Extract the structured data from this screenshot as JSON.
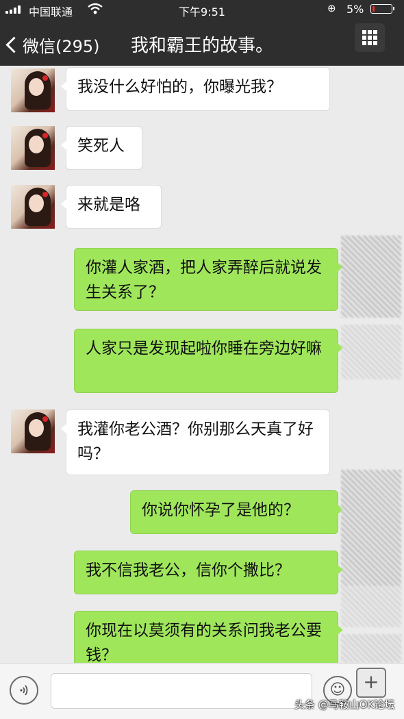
{
  "status_bar": {
    "carrier": "中国联通",
    "time": "下午9:51",
    "battery": "5%",
    "icons": [
      "signal-icon",
      "wifi-icon",
      "orientation-lock-icon",
      "battery-icon"
    ]
  },
  "nav": {
    "back_label": "微信(295)",
    "title": "我和霸王的故事。",
    "more_icon": "grid-menu-icon"
  },
  "messages": [
    {
      "side": "left",
      "text": "我没什么好怕的，你曝光我？"
    },
    {
      "side": "left",
      "text": "笑死人"
    },
    {
      "side": "left",
      "text": "来就是咯"
    },
    {
      "side": "right",
      "text": "你灌人家酒，把人家弄醉后就说发生关系了？"
    },
    {
      "side": "right",
      "text": "人家只是发现起啦你睡在旁边好嘛"
    },
    {
      "side": "left",
      "text": "我灌你老公酒？你别那么天真了好吗？"
    },
    {
      "side": "right",
      "text": "你说你怀孕了是他的？"
    },
    {
      "side": "right",
      "text": "我不信我老公，信你个撒比？"
    },
    {
      "side": "right",
      "text": "你现在以莫须有的关系问我老公要钱？"
    }
  ],
  "input_bar": {
    "icons": [
      "voice-icon",
      "emoji-icon",
      "plus-icon"
    ]
  },
  "watermark": "头条 @马鞍山OK论坛",
  "colors": {
    "bar_bg": "#2e2e2e",
    "chat_bg": "#ebebeb",
    "bubble_right": "#9fe65b",
    "bubble_left": "#ffffff"
  }
}
